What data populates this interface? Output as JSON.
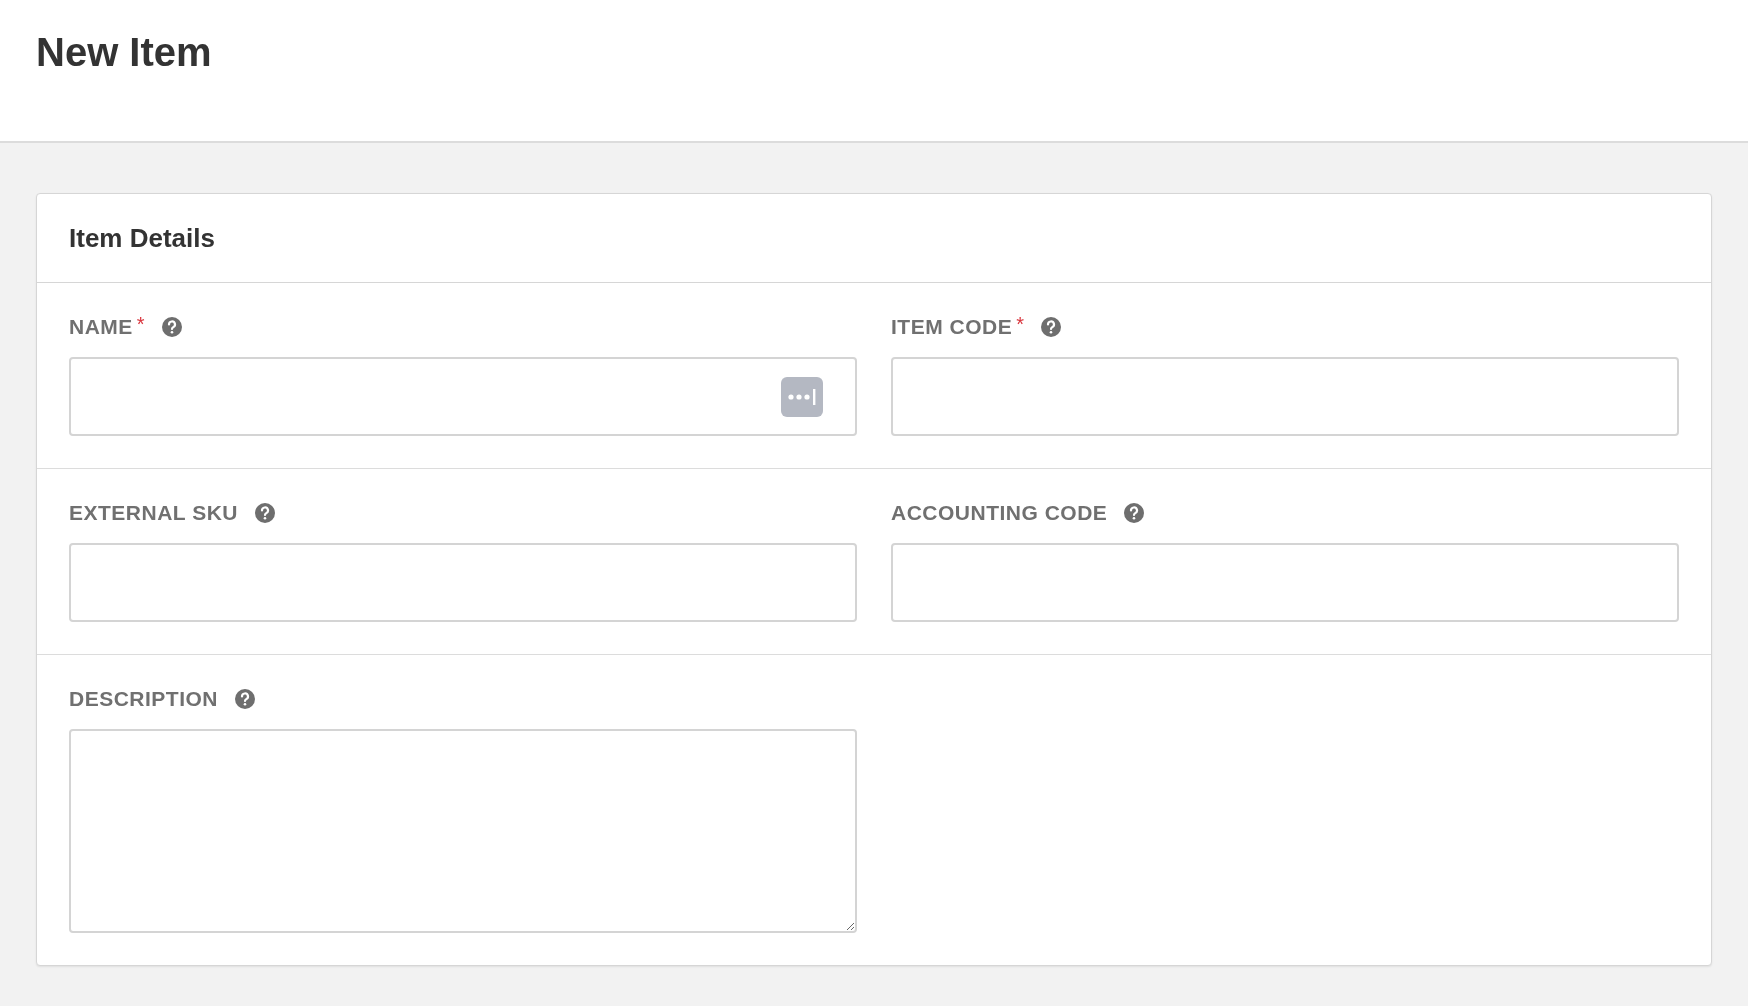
{
  "page": {
    "title": "New Item"
  },
  "card": {
    "title": "Item Details",
    "rows": [
      {
        "fields": [
          {
            "label": "NAME",
            "required_mark": "*",
            "kind": "input",
            "autofill_icon": true
          },
          {
            "label": "ITEM CODE",
            "required_mark": "*",
            "kind": "input",
            "autofill_icon": false
          }
        ]
      },
      {
        "fields": [
          {
            "label": "EXTERNAL SKU",
            "kind": "input",
            "autofill_icon": false
          },
          {
            "label": "ACCOUNTING CODE",
            "kind": "input",
            "autofill_icon": false
          }
        ]
      },
      {
        "fields": [
          {
            "label": "DESCRIPTION",
            "kind": "textarea"
          }
        ]
      }
    ]
  }
}
